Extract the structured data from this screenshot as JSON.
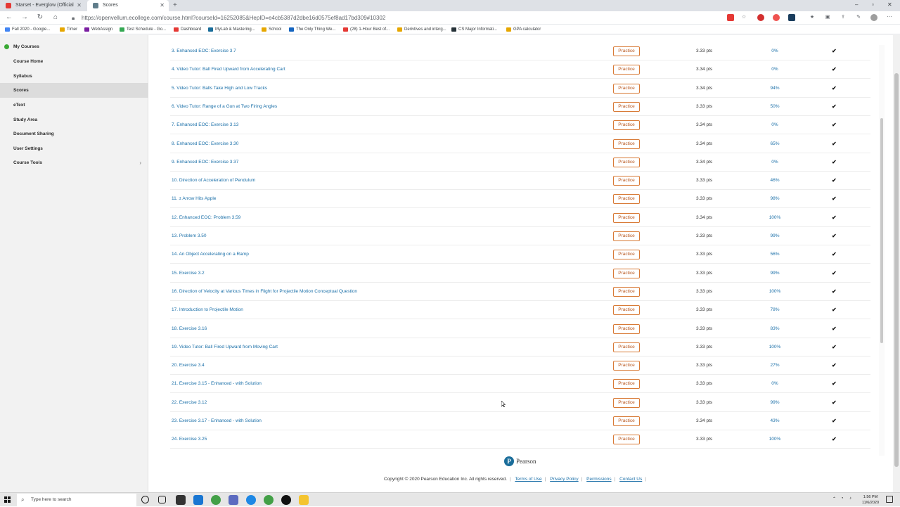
{
  "browser": {
    "tabs": [
      {
        "title": "Starset - Everglow (Official",
        "icon_color": "#e53935"
      },
      {
        "title": "Scores",
        "icon_color": "#607d8b"
      }
    ],
    "url": "https://openvellum.ecollege.com/course.html?courseId=16252085&HepID=e4cb5387d2dbe16d0575ef8ad17bd309#10302",
    "bookmarks": [
      {
        "label": "Fall 2020 - Google...",
        "color": "#4285f4"
      },
      {
        "label": "Timer",
        "color": "#e6a700"
      },
      {
        "label": "WebAssign",
        "color": "#7b1fa2"
      },
      {
        "label": "Test Schedule - Go...",
        "color": "#34a853"
      },
      {
        "label": "Dashboard",
        "color": "#e53935"
      },
      {
        "label": "MyLab & Mastering...",
        "color": "#1a6d9a"
      },
      {
        "label": "School",
        "color": "#e6a700"
      },
      {
        "label": "The Only Thing We...",
        "color": "#1565c0"
      },
      {
        "label": "(28) 1-Hour Best of...",
        "color": "#e53935"
      },
      {
        "label": "Derivtives and interg...",
        "color": "#e6a700"
      },
      {
        "label": "CS Major Informati...",
        "color": "#263238"
      },
      {
        "label": "GPA calculator",
        "color": "#e6a700"
      }
    ]
  },
  "sidebar": {
    "items": [
      {
        "label": "My Courses"
      },
      {
        "label": "Course Home"
      },
      {
        "label": "Syllabus"
      },
      {
        "label": "Scores"
      },
      {
        "label": "eText"
      },
      {
        "label": "Study Area"
      },
      {
        "label": "Document Sharing"
      },
      {
        "label": "User Settings"
      },
      {
        "label": "Course Tools"
      }
    ]
  },
  "table": {
    "practice_label": "Practice",
    "rows": [
      {
        "title": "3. Enhanced EOC: Exercise 3.7",
        "pts": "3.33 pts",
        "score": "0%"
      },
      {
        "title": "4. Video Tutor: Ball Fired Upward from Accelerating Cart",
        "pts": "3.34 pts",
        "score": "0%"
      },
      {
        "title": "5. Video Tutor: Balls Take High and Low Tracks",
        "pts": "3.34 pts",
        "score": "94%"
      },
      {
        "title": "6. Video Tutor: Range of a Gun at Two Firing Angles",
        "pts": "3.33 pts",
        "score": "50%"
      },
      {
        "title": "7. Enhanced EOC: Exercise 3.13",
        "pts": "3.34 pts",
        "score": "0%"
      },
      {
        "title": "8. Enhanced EOC: Exercise 3.30",
        "pts": "3.34 pts",
        "score": "65%"
      },
      {
        "title": "9. Enhanced EOC: Exercise 3.37",
        "pts": "3.34 pts",
        "score": "0%"
      },
      {
        "title": "10. Direction of Acceleration of Pendulum",
        "pts": "3.33 pts",
        "score": "46%"
      },
      {
        "title": "11. ± Arrow Hits Apple",
        "pts": "3.33 pts",
        "score": "98%"
      },
      {
        "title": "12. Enhanced EOC: Problem 3.59",
        "pts": "3.34 pts",
        "score": "100%"
      },
      {
        "title": "13. Problem 3.50",
        "pts": "3.33 pts",
        "score": "99%"
      },
      {
        "title": "14. An Object Accelerating on a Ramp",
        "pts": "3.33 pts",
        "score": "56%"
      },
      {
        "title": "15. Exercise 3.2",
        "pts": "3.33 pts",
        "score": "99%"
      },
      {
        "title": "16. Direction of Velocity at Various Times in Flight for Projectile Motion Conceptual Question",
        "pts": "3.33 pts",
        "score": "100%"
      },
      {
        "title": "17. Introduction to Projectile Motion",
        "pts": "3.33 pts",
        "score": "78%"
      },
      {
        "title": "18. Exercise 3.16",
        "pts": "3.33 pts",
        "score": "83%"
      },
      {
        "title": "19. Video Tutor: Ball Fired Upward from Moving Cart",
        "pts": "3.33 pts",
        "score": "100%"
      },
      {
        "title": "20. Exercise 3.4",
        "pts": "3.33 pts",
        "score": "27%"
      },
      {
        "title": "21. Exercise 3.15 - Enhanced - with Solution",
        "pts": "3.33 pts",
        "score": "0%"
      },
      {
        "title": "22. Exercise 3.12",
        "pts": "3.33 pts",
        "score": "99%"
      },
      {
        "title": "23. Exercise 3.17 - Enhanced - with Solution",
        "pts": "3.34 pts",
        "score": "43%"
      },
      {
        "title": "24. Exercise 3.25",
        "pts": "3.33 pts",
        "score": "100%"
      }
    ]
  },
  "footer": {
    "logo_text": "Pearson",
    "copyright": "Copyright © 2020 Pearson Education Inc. All rights reserved.",
    "links": [
      "Terms of Use",
      "Privacy Policy",
      "Permissions",
      "Contact Us"
    ]
  },
  "taskbar": {
    "search_placeholder": "Type here to search",
    "time": "1:56 PM",
    "date": "11/6/2020"
  },
  "colors": {
    "link": "#1a6fa8",
    "practice_border": "#d87a36",
    "sidebar_bg": "#f2f2f2"
  }
}
